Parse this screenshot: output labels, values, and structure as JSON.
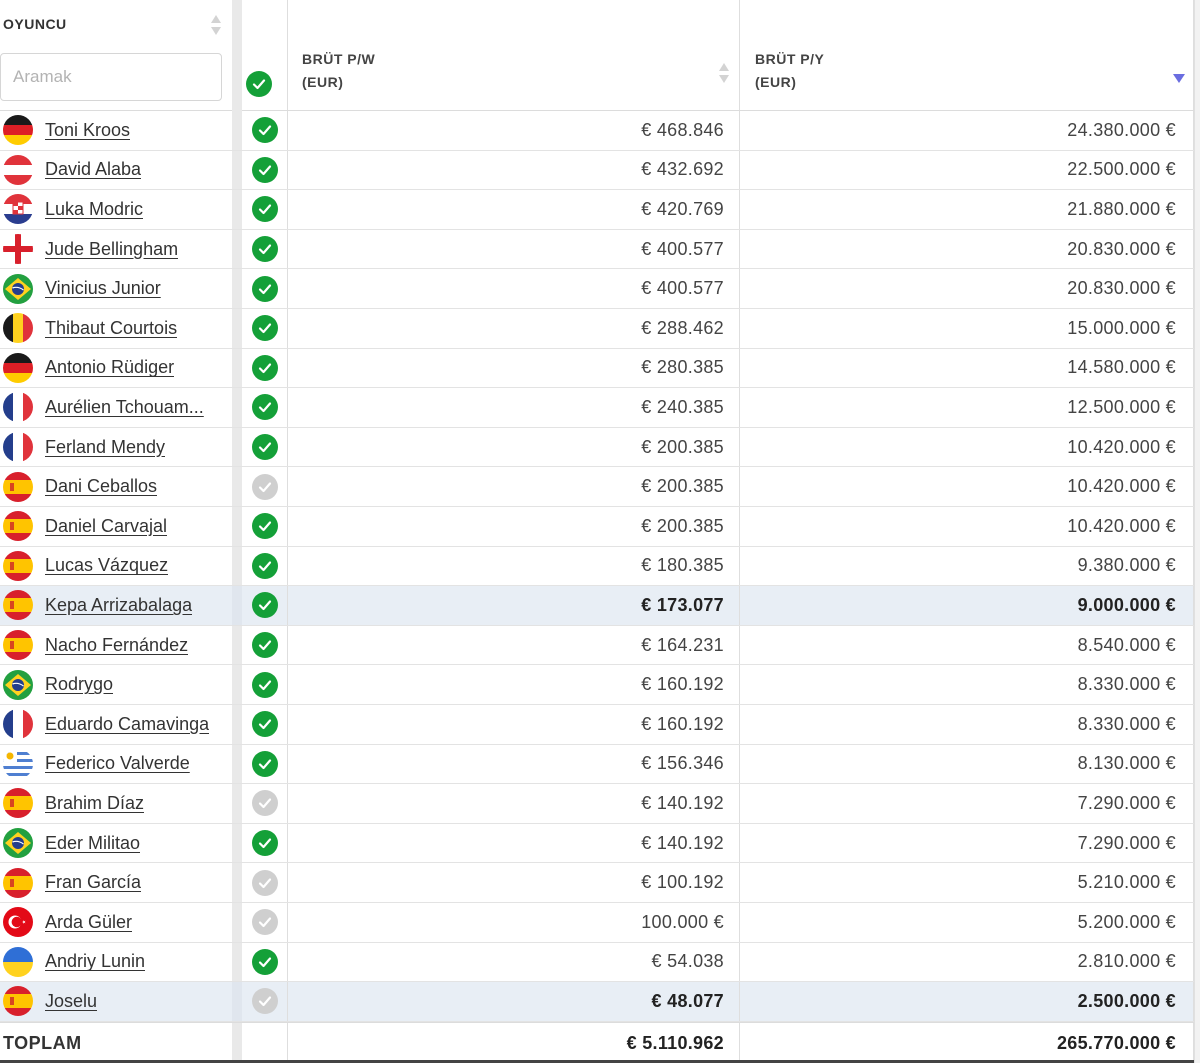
{
  "header": {
    "player_title": "OYUNCU",
    "search_placeholder": "Aramak",
    "pw_label_line1": "BRÜT P/W",
    "pw_label_line2": "(EUR)",
    "py_label_line1": "BRÜT P/Y",
    "py_label_line2": "(EUR)"
  },
  "rows": [
    {
      "name": "Toni Kroos",
      "flag": "germany",
      "status": "confirmed",
      "pw": "€ 468.846",
      "py": "24.380.000 €"
    },
    {
      "name": "David Alaba",
      "flag": "austria",
      "status": "confirmed",
      "pw": "€ 432.692",
      "py": "22.500.000 €"
    },
    {
      "name": "Luka Modric",
      "flag": "croatia",
      "status": "confirmed",
      "pw": "€ 420.769",
      "py": "21.880.000 €"
    },
    {
      "name": "Jude Bellingham",
      "flag": "england",
      "status": "confirmed",
      "pw": "€ 400.577",
      "py": "20.830.000 €"
    },
    {
      "name": "Vinicius Junior",
      "flag": "brazil",
      "status": "confirmed",
      "pw": "€ 400.577",
      "py": "20.830.000 €"
    },
    {
      "name": "Thibaut Courtois",
      "flag": "belgium",
      "status": "confirmed",
      "pw": "€ 288.462",
      "py": "15.000.000 €"
    },
    {
      "name": "Antonio Rüdiger",
      "flag": "germany",
      "status": "confirmed",
      "pw": "€ 280.385",
      "py": "14.580.000 €"
    },
    {
      "name": "Aurélien Tchouam...",
      "flag": "france",
      "status": "confirmed",
      "pw": "€ 240.385",
      "py": "12.500.000 €"
    },
    {
      "name": "Ferland Mendy",
      "flag": "france",
      "status": "confirmed",
      "pw": "€ 200.385",
      "py": "10.420.000 €"
    },
    {
      "name": "Dani Ceballos",
      "flag": "spain",
      "status": "unconfirmed",
      "pw": "€ 200.385",
      "py": "10.420.000 €"
    },
    {
      "name": "Daniel Carvajal",
      "flag": "spain",
      "status": "confirmed",
      "pw": "€ 200.385",
      "py": "10.420.000 €"
    },
    {
      "name": "Lucas Vázquez",
      "flag": "spain",
      "status": "confirmed",
      "pw": "€ 180.385",
      "py": "9.380.000 €"
    },
    {
      "name": "Kepa Arrizabalaga",
      "flag": "spain",
      "status": "confirmed",
      "pw": "€ 173.077",
      "py": "9.000.000 €",
      "highlight": true
    },
    {
      "name": "Nacho Fernández",
      "flag": "spain",
      "status": "confirmed",
      "pw": "€ 164.231",
      "py": "8.540.000 €"
    },
    {
      "name": "Rodrygo",
      "flag": "brazil",
      "status": "confirmed",
      "pw": "€ 160.192",
      "py": "8.330.000 €"
    },
    {
      "name": "Eduardo Camavinga",
      "flag": "france",
      "status": "confirmed",
      "pw": "€ 160.192",
      "py": "8.330.000 €"
    },
    {
      "name": "Federico Valverde",
      "flag": "uruguay",
      "status": "confirmed",
      "pw": "€ 156.346",
      "py": "8.130.000 €"
    },
    {
      "name": "Brahim Díaz",
      "flag": "spain",
      "status": "unconfirmed",
      "pw": "€ 140.192",
      "py": "7.290.000 €"
    },
    {
      "name": "Eder Militao",
      "flag": "brazil",
      "status": "confirmed",
      "pw": "€ 140.192",
      "py": "7.290.000 €"
    },
    {
      "name": "Fran García",
      "flag": "spain",
      "status": "unconfirmed",
      "pw": "€ 100.192",
      "py": "5.210.000 €"
    },
    {
      "name": "Arda Güler",
      "flag": "turkey",
      "status": "unconfirmed",
      "pw": "100.000 €",
      "py": "5.200.000 €"
    },
    {
      "name": "Andriy Lunin",
      "flag": "ukraine",
      "status": "confirmed",
      "pw": "€ 54.038",
      "py": "2.810.000 €"
    },
    {
      "name": "Joselu",
      "flag": "spain",
      "status": "unconfirmed",
      "pw": "€ 48.077",
      "py": "2.500.000 €",
      "highlight": true
    }
  ],
  "total": {
    "label": "TOPLAM",
    "pw": "€ 5.110.962",
    "py": "265.770.000 €"
  },
  "colors": {
    "confirmed": "#14a038",
    "unconfirmed": "#cfcfcf",
    "sort_active": "#6a6de0",
    "highlight_row": "#e8eef5"
  }
}
